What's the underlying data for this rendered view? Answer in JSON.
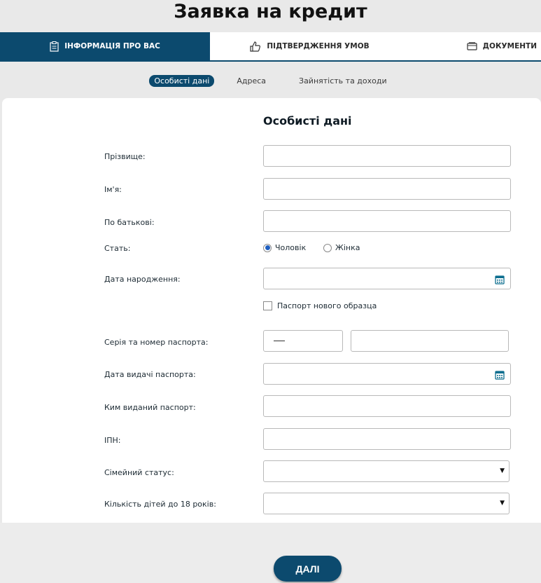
{
  "page": {
    "title": "Заявка на кредит"
  },
  "tabs": [
    {
      "label": "ІНФОРМАЦІЯ ПРО ВАС",
      "icon": "clipboard-icon",
      "active": true
    },
    {
      "label": "ПІДТВЕРДЖЕННЯ УМОВ",
      "icon": "thumbs-up-icon",
      "active": false
    },
    {
      "label": "ДОКУМЕНТИ",
      "icon": "documents-icon",
      "active": false
    }
  ],
  "subtabs": [
    {
      "label": "Особисті дані",
      "active": true
    },
    {
      "label": "Адреса",
      "active": false
    },
    {
      "label": "Зайнятість та доходи",
      "active": false
    }
  ],
  "section": {
    "title": "Особисті дані"
  },
  "fields": {
    "surname": {
      "label": "Прізвище:",
      "value": ""
    },
    "name": {
      "label": "Ім'я:",
      "value": ""
    },
    "patronymic": {
      "label": "По батькові:",
      "value": ""
    },
    "gender": {
      "label": "Стать:",
      "options": [
        "Чоловік",
        "Жінка"
      ],
      "selected": "Чоловік"
    },
    "birth_date": {
      "label": "Дата народження:",
      "value": "",
      "icon": "calendar-icon"
    },
    "new_passport": {
      "label": "Паспорт нового образца",
      "checked": false
    },
    "passport_number": {
      "label": "Серія та номер паспорта:",
      "series": "",
      "number": ""
    },
    "passport_issue_date": {
      "label": "Дата видачі паспорта:",
      "value": "",
      "icon": "calendar-icon"
    },
    "passport_issuer": {
      "label": "Ким виданий паспорт:",
      "value": ""
    },
    "tax_id": {
      "label": "ІПН:",
      "value": ""
    },
    "marital_status": {
      "label": "Сімейний статус:",
      "value": ""
    },
    "children": {
      "label": "Кількість дітей до 18 років:",
      "value": ""
    }
  },
  "actions": {
    "next_label": "ДАЛІ"
  },
  "colors": {
    "primary": "#0c4a6e",
    "radio_accent": "#1f5fbf",
    "background": "#e9e9e9"
  }
}
